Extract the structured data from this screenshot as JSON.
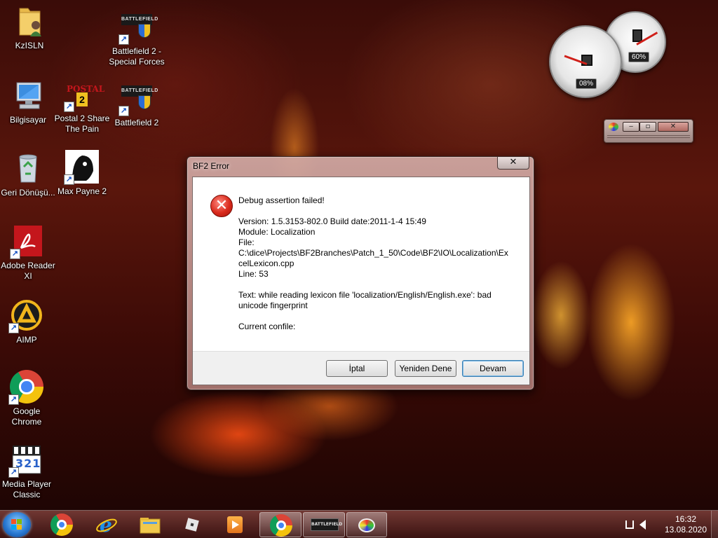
{
  "desktop": {
    "icons": [
      {
        "label": "KzISLN",
        "icon": "folder-icon"
      },
      {
        "label": "Bilgisayar",
        "icon": "computer-icon"
      },
      {
        "label": "Geri Dönüşü...",
        "icon": "recycle-bin-icon"
      },
      {
        "label": "Adobe Reader XI",
        "icon": "adobe-reader-icon"
      },
      {
        "label": "AIMP",
        "icon": "aimp-icon"
      },
      {
        "label": "Google Chrome",
        "icon": "chrome-icon"
      },
      {
        "label": "Media Player Classic",
        "icon": "media-player-icon"
      },
      {
        "label": "Battlefield 2 - Special Forces",
        "icon": "battlefield-icon"
      },
      {
        "label": "Postal 2 Share The Pain",
        "icon": "postal-icon"
      },
      {
        "label": "Battlefield 2",
        "icon": "battlefield-icon"
      },
      {
        "label": "Max Payne 2",
        "icon": "max-payne-icon"
      }
    ],
    "icon_badges": {
      "postal_top": "POSTAL",
      "postal_num": "2",
      "battlefield_text": "BATTLEFIELD",
      "mpc_digits": "321"
    }
  },
  "gadgets": {
    "cpu_readout": "08%",
    "ram_readout": "60%",
    "cpu_level_percent": 8,
    "ram_level_percent": 60
  },
  "dialog": {
    "title": "BF2 Error",
    "close_label": "✕",
    "error_glyph": "✕",
    "heading": "Debug assertion failed!",
    "version": "Version: 1.5.3153-802.0 Build date:2011-1-4 15:49",
    "module": "Module: Localization",
    "file_label": "File:",
    "file_path": "C:\\dice\\Projects\\BF2Branches\\Patch_1_50\\Code\\BF2\\IO\\Localization\\Ex",
    "file_path_cont": "celLexicon.cpp",
    "line": "Line: 53",
    "text_line1": "Text: while reading lexicon file 'localization/English/English.exe': bad",
    "text_line2": "unicode fingerprint",
    "confile": "Current confile:",
    "buttons": {
      "cancel": "İptal",
      "retry": "Yeniden Dene",
      "continue": "Devam"
    }
  },
  "taskbar": {
    "clock_time": "16:32",
    "clock_date": "13.08.2020",
    "pinned": [
      "chrome-icon",
      "internet-explorer-icon",
      "file-explorer-icon",
      "roblox-icon",
      "media-player-icon",
      "chrome-icon",
      "battlefield-icon",
      "paint-icon"
    ]
  },
  "colors": {
    "error_red": "#d92a1c",
    "dialog_frame": "#b98680",
    "taskbar": "#5a1e1a"
  }
}
